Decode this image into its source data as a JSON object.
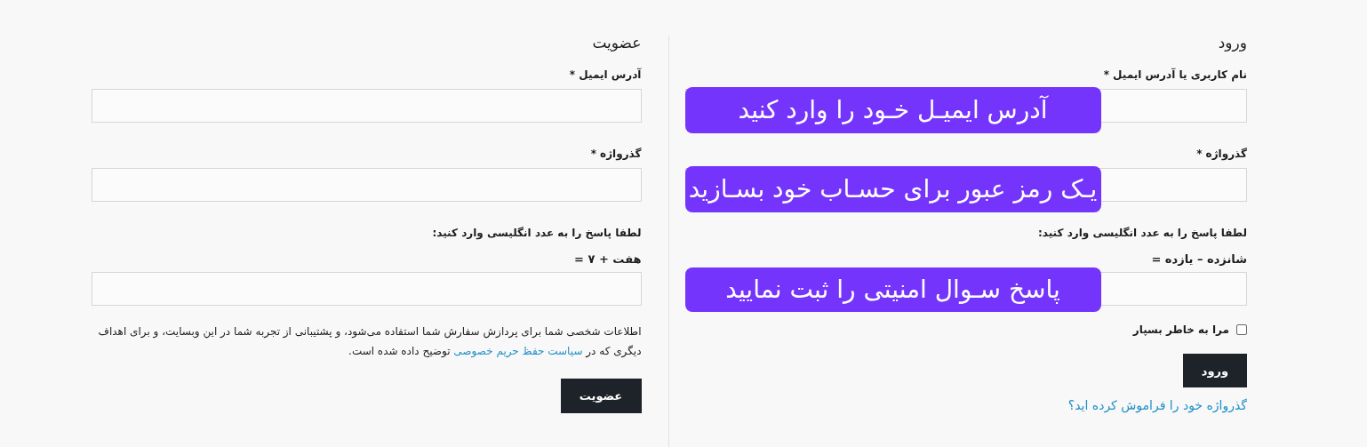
{
  "login": {
    "title": "ورود",
    "fields": [
      {
        "label": "نام کاربری یا آدرس ایمیل *",
        "callout": "آدرس ایمیـل خـود را وارد کنید"
      },
      {
        "label": "گذرواژه *",
        "callout": "یـک رمز عبور برای حسـاب خود بسـازید"
      }
    ],
    "captcha_prompt": "لطفا پاسخ را به عدد انگلیسی وارد کنید:",
    "captcha_question": "شانزده – یازده =",
    "captcha_callout": "پاسخ سـوال امنیتی را ثبت نمایید",
    "remember": {
      "label": "مرا به خاطر بسپار",
      "checked": false
    },
    "button": "ورود",
    "forgot_link": "گذرواژه خود را فراموش کرده اید؟"
  },
  "register": {
    "title": "عضویت",
    "fields": [
      {
        "label": "آدرس ایمیل *"
      },
      {
        "label": "گذرواژه *"
      }
    ],
    "captcha_prompt": "لطفا پاسخ را به عدد انگلیسی وارد کنید:",
    "captcha_question": "هفت + ۷ =",
    "privacy_before": "اطلاعات شخصی شما برای پردازش سفارش شما استفاده می‌شود، و پشتیبانی از تجربه شما در این وبسایت، و برای اهداف دیگری که در ",
    "privacy_link": "سیاست حفظ حریم خصوصی",
    "privacy_after": " توضیح داده شده است.",
    "button": "عضویت"
  }
}
